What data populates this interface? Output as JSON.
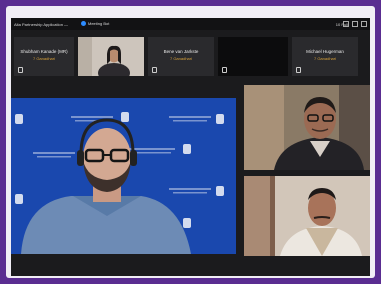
{
  "window": {
    "title": "Alta Partnership Application —",
    "status": "Meeting Bot",
    "right_label": "10 Pull"
  },
  "thumbnails": [
    {
      "name": "Shubham Kanade (MR)",
      "role": "7 Ganadhari"
    },
    {
      "name": "",
      "role": ""
    },
    {
      "name": "Bene van Jarkste",
      "role": "7 Ganadhari"
    },
    {
      "name": "",
      "role": ""
    },
    {
      "name": "Michael Hugerman",
      "role": "7 Ganadhari"
    }
  ],
  "colors": {
    "outer_background": "#5a2d91",
    "meeting_background": "#1b1b1d",
    "banner_blue": "#1844a9",
    "role_text": "#d6a03a"
  }
}
